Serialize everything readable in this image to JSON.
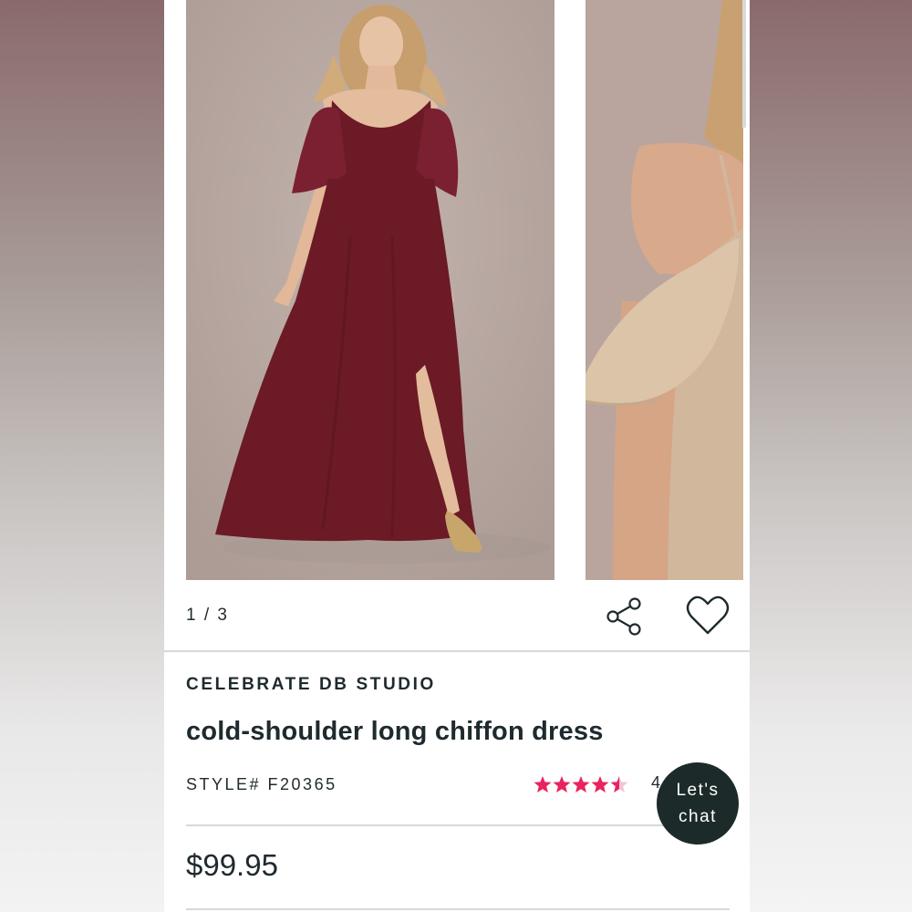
{
  "gallery": {
    "pager_text": "1 / 3",
    "current_index": 1,
    "total": 3
  },
  "product": {
    "brand": "CELEBRATE DB STUDIO",
    "title": "cold-shoulder long chiffon dress",
    "style": "STYLE# F20365",
    "rating_value": 4.5,
    "rating_max": 5,
    "review_count_partial": "4",
    "price": "$99.95"
  },
  "chat": {
    "line1": "Let's",
    "line2": "chat"
  },
  "colors": {
    "star": "#e8245f",
    "text": "#1f2a2e",
    "chat_bg": "#1c2b29",
    "dress_main": "#6b1a26",
    "dress_alt": "#d1b79c"
  },
  "icons": [
    "share-icon",
    "heart-icon",
    "star-icon"
  ]
}
